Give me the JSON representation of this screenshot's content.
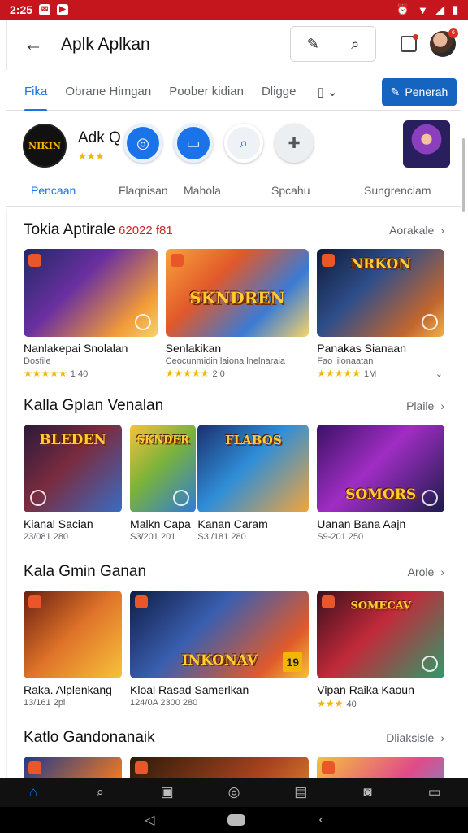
{
  "status": {
    "time": "2:25",
    "icons_left": [
      "message-icon",
      "youtube-icon"
    ],
    "icons_right": [
      "alarm-icon",
      "wifi-icon",
      "signal-icon",
      "battery-icon"
    ]
  },
  "appbar": {
    "title": "Aplk Aplkan",
    "notification_badge": "6"
  },
  "tabs": {
    "items": [
      "Fika",
      "Obrane Himgan",
      "Poober kidian",
      "Dligge"
    ],
    "action_label": "Penerah"
  },
  "app": {
    "logo_text": "NIKIN",
    "name": "Adk Q",
    "rating_stars": "★★★",
    "circle_icons": [
      "game-controller-icon",
      "car-icon",
      "search-app-icon",
      "puzzle-icon"
    ]
  },
  "subtabs": [
    "Pencaan",
    "Flaqnisan",
    "Mahola",
    "Spcahu",
    "Sungrenclam"
  ],
  "sections": [
    {
      "title": "Tokia Aptirale",
      "title_extra": "62022 f81",
      "more": "Aorakale",
      "cards": [
        {
          "title": "Nanlakepai Snolalan",
          "sub": "Dosfile",
          "stars": "★★★★★",
          "count": "1 40"
        },
        {
          "title": "Senlakikan",
          "sub": "Ceocunmidin laiona lnelnaraia",
          "stars": "★★★★★",
          "count": "2 0",
          "img_label": "SKNDREN"
        },
        {
          "title": "Panakas Sianaan",
          "sub": "Fao lilonaatan",
          "stars": "★★★★★",
          "count": "1M",
          "img_label": "NRKON"
        }
      ]
    },
    {
      "title": "Kalla Gplan Venalan",
      "more": "Plaile",
      "cards": [
        {
          "title": "Kianal Sacian",
          "sub": "23/081 280",
          "img_label": "BLEDEN"
        },
        {
          "title": "Malkn Capa",
          "sub": "S3/201 201",
          "img_label": "SKNDER"
        },
        {
          "title": "Kanan Caram",
          "sub": "S3 /181 280",
          "img_label": "FLABOS"
        },
        {
          "title": "Uanan Bana Aajn",
          "sub": "S9-201 250",
          "img_label": "SOMORS"
        }
      ]
    },
    {
      "title": "Kala Gmin Ganan",
      "more": "Arole",
      "cards": [
        {
          "title": "Raka. Alplenkang",
          "sub": "13/161 2pi"
        },
        {
          "title": "Kloal Rasad Samerlkan",
          "sub": "124/0A 2300 280",
          "img_label": "INKONAV",
          "badge": "19"
        },
        {
          "title": "Vipan Raika Kaoun",
          "sub": "",
          "stars": "★★★",
          "count": "40",
          "img_label": "SOMECAV"
        }
      ]
    },
    {
      "title": "Katlo Gandonanaik",
      "more": "Dliaksisle"
    }
  ],
  "bottomnav": [
    "home-icon",
    "search-icon",
    "apps-icon",
    "compass-icon",
    "inbox-icon",
    "games-icon",
    "library-icon"
  ]
}
